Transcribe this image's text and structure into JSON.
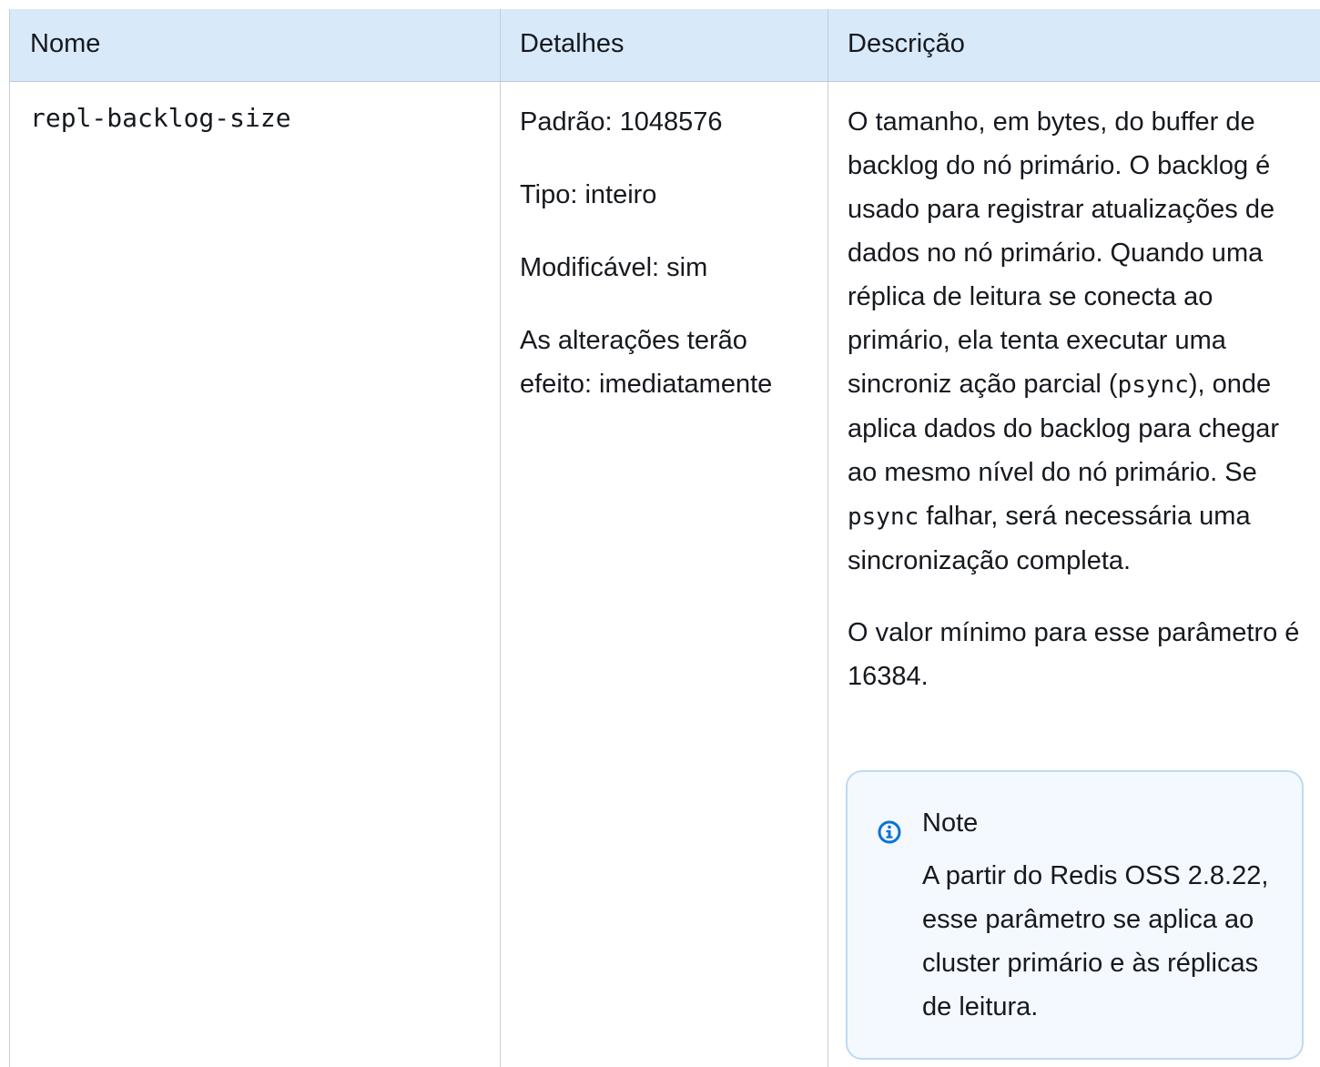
{
  "table": {
    "headers": [
      "Nome",
      "Detalhes",
      "Descrição"
    ],
    "row": {
      "name": "repl-backlog-size",
      "details": {
        "default": "Padrão: 1048576",
        "type": "Tipo: inteiro",
        "modifiable": "Modificável: sim",
        "effect_line1": "As alterações terão",
        "effect_line2": "efeito: imediatamente"
      },
      "description": {
        "p1_part1": "O tamanho, em bytes, do buffer de backlog do nó primário. O backlog é usado para registrar atualizações de dados no nó primário. Quando uma réplica de leitura se conecta ao primário, ela tenta executar uma sincroniz ação parcial (",
        "p1_code1": "psync",
        "p1_part2": "), onde aplica dados do backlog para chegar ao mesmo nível do nó primário. Se ",
        "p1_code2": "psync",
        "p1_part3": " falhar, será necessária uma sincronização completa.",
        "p2": "O valor mínimo para esse parâmetro é 16384."
      },
      "note": {
        "icon": "info-icon",
        "title": "Note",
        "body": "A partir do Redis OSS 2.8.22, esse parâmetro se aplica ao cluster primário e às réplicas de leitura."
      }
    }
  },
  "colors": {
    "header_bg": "#d8e9fa",
    "note_bg": "#f3f9fe",
    "note_border": "#bfd9f2",
    "info_icon": "#0972d3"
  }
}
